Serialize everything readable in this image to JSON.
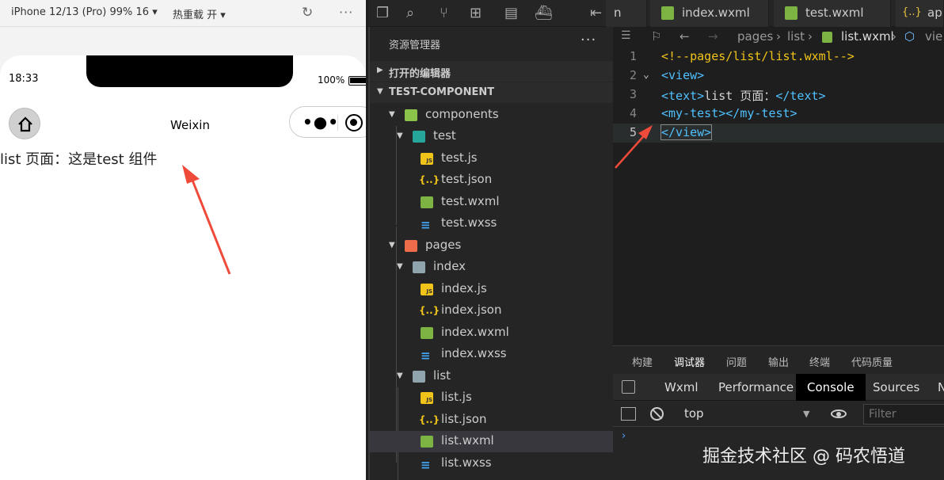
{
  "simulator": {
    "device_label": "iPhone 12/13 (Pro) 99% 16 ▾",
    "hot_reload_label": "热重载 开 ▾",
    "status_time": "18:33",
    "battery": "100%",
    "nav_title": "Weixin",
    "page_text": "list 页面：这是test 组件"
  },
  "tabs": [
    {
      "label": "n"
    },
    {
      "label": "index.wxml"
    },
    {
      "label": "test.wxml"
    },
    {
      "label": "app"
    }
  ],
  "explorer": {
    "header": "资源管理器",
    "open_editors": "打开的编辑器",
    "project": "TEST-COMPONENT",
    "tree": [
      {
        "label": "components"
      },
      {
        "label": "test"
      },
      {
        "label": "test.js"
      },
      {
        "label": "test.json"
      },
      {
        "label": "test.wxml"
      },
      {
        "label": "test.wxss"
      },
      {
        "label": "pages"
      },
      {
        "label": "index"
      },
      {
        "label": "index.js"
      },
      {
        "label": "index.json"
      },
      {
        "label": "index.wxml"
      },
      {
        "label": "index.wxss"
      },
      {
        "label": "list"
      },
      {
        "label": "list.js"
      },
      {
        "label": "list.json"
      },
      {
        "label": "list.wxml"
      },
      {
        "label": "list.wxss"
      }
    ]
  },
  "breadcrumb": {
    "items": [
      "pages",
      "list",
      "list.wxml",
      "vie"
    ]
  },
  "code": {
    "lines": [
      {
        "num": "1",
        "text": "<!--pages/list/list.wxml-->"
      },
      {
        "num": "2",
        "text": "<view>"
      },
      {
        "num": "3",
        "open": "<text>",
        "content": "list 页面：",
        "close": "</text>"
      },
      {
        "num": "4",
        "text": "<my-test></my-test>"
      },
      {
        "num": "5",
        "text": "</view>"
      }
    ]
  },
  "panel": {
    "tabs": [
      "构建",
      "调试器",
      "问题",
      "输出",
      "终端",
      "代码质量"
    ],
    "devtools_tabs": [
      "Wxml",
      "Performance",
      "Console",
      "Sources",
      "N"
    ],
    "context": "top",
    "filter_placeholder": "Filter",
    "prompt": "›"
  },
  "watermark": "掘金技术社区 @ 码农悟道"
}
